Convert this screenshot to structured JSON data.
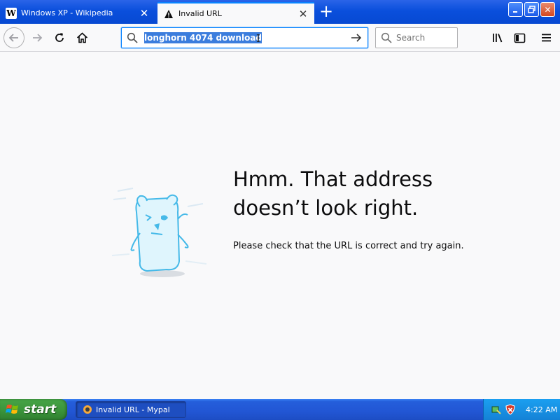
{
  "tabs": [
    {
      "title": "Windows XP - Wikipedia",
      "favicon": "W",
      "active": false
    },
    {
      "title": "Invalid URL",
      "favicon": "warning-icon",
      "active": true
    }
  ],
  "window_controls": [
    "minimize",
    "restore",
    "close"
  ],
  "navbar": {
    "url_query": "longhorn 4074 download",
    "search_placeholder": "Search"
  },
  "error_page": {
    "title_line1": "Hmm. That address",
    "title_line2": "doesn’t look right.",
    "description": "Please check that the URL is correct and try again."
  },
  "taskbar": {
    "start_label": "start",
    "task_item": "Invalid URL - Mypal",
    "clock": "4:22 AM"
  },
  "colors": {
    "accent": "#0a84ff",
    "xp_blue": "#245edb",
    "start_green": "#3c963c",
    "page_bg": "#f9f9fa"
  }
}
